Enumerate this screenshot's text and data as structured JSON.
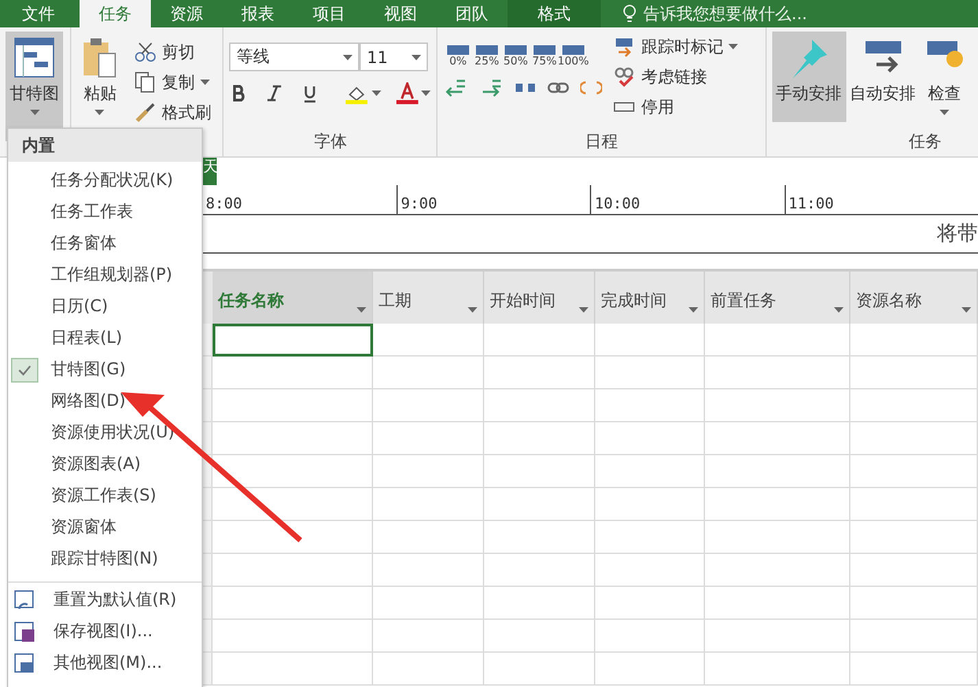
{
  "menu_tabs": [
    {
      "label": "文件",
      "selected": false,
      "kind": "file"
    },
    {
      "label": "任务",
      "selected": true,
      "kind": "tab"
    },
    {
      "label": "资源",
      "selected": false,
      "kind": "tab"
    },
    {
      "label": "报表",
      "selected": false,
      "kind": "tab"
    },
    {
      "label": "项目",
      "selected": false,
      "kind": "tab"
    },
    {
      "label": "视图",
      "selected": false,
      "kind": "tab"
    },
    {
      "label": "团队",
      "selected": false,
      "kind": "tab"
    },
    {
      "label": "格式",
      "selected": false,
      "kind": "context"
    }
  ],
  "tell_me": {
    "placeholder": "告诉我您想要做什么..."
  },
  "ribbon": {
    "view_button": "甘特图",
    "clipboard": {
      "paste": "粘贴",
      "cut": "剪切",
      "copy": "复制",
      "format_painter": "格式刷"
    },
    "font": {
      "name": "等线",
      "size": "11",
      "label": "字体"
    },
    "schedule": {
      "percent_buttons": [
        "0%",
        "25%",
        "50%",
        "75%",
        "100%"
      ],
      "track": "跟踪时标记",
      "respect_links": "考虑链接",
      "inactivate": "停用",
      "label": "日程"
    },
    "tasks": {
      "buttons": [
        {
          "label": "手动安排",
          "selected": true
        },
        {
          "label": "自动安排",
          "selected": false
        }
      ],
      "inspect": "检查",
      "label": "任务"
    }
  },
  "view_menu": {
    "header": "内置",
    "items": [
      {
        "label": "任务分配状况(K)",
        "checked": false
      },
      {
        "label": "任务工作表",
        "checked": false
      },
      {
        "label": "任务窗体",
        "checked": false
      },
      {
        "label": "工作组规划器(P)",
        "checked": false
      },
      {
        "label": "日历(C)",
        "checked": false
      },
      {
        "label": "日程表(L)",
        "checked": false
      },
      {
        "label": "甘特图(G)",
        "checked": true
      },
      {
        "label": "网络图(D)",
        "checked": false
      },
      {
        "label": "资源使用状况(U)",
        "checked": false
      },
      {
        "label": "资源图表(A)",
        "checked": false
      },
      {
        "label": "资源工作表(S)",
        "checked": false
      },
      {
        "label": "资源窗体",
        "checked": false
      },
      {
        "label": "跟踪甘特图(N)",
        "checked": false
      }
    ],
    "commands": [
      {
        "label": "重置为默认值(R)",
        "kind": "reset"
      },
      {
        "label": "保存视图(I)...",
        "kind": "save"
      },
      {
        "label": "其他视图(M)...",
        "kind": "more"
      }
    ]
  },
  "timeline": {
    "tab": "天",
    "ticks": [
      "8:00",
      "9:00",
      "10:00",
      "11:00"
    ],
    "note": "将带"
  },
  "table": {
    "columns": [
      {
        "label": "任务名称",
        "selected": true
      },
      {
        "label": "工期",
        "selected": false
      },
      {
        "label": "开始时间",
        "selected": false
      },
      {
        "label": "完成时间",
        "selected": false
      },
      {
        "label": "前置任务",
        "selected": false
      },
      {
        "label": "资源名称",
        "selected": false
      }
    ]
  }
}
